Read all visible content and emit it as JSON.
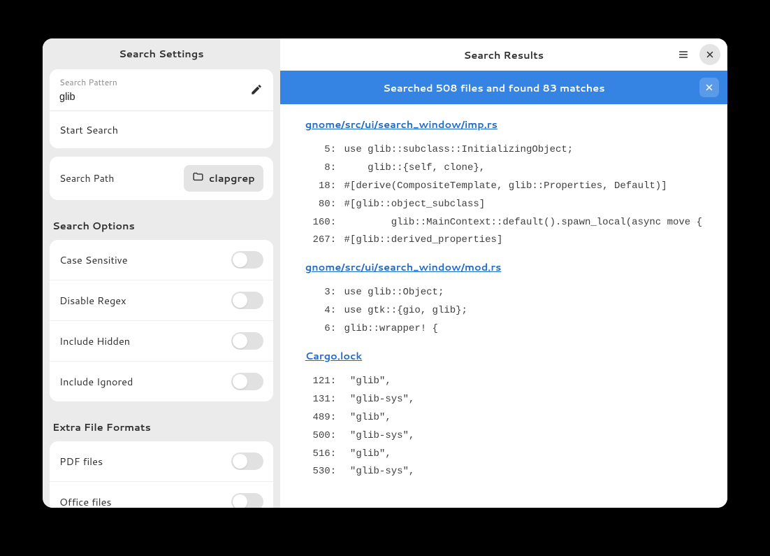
{
  "sidebar": {
    "title": "Search Settings",
    "pattern_label": "Search Pattern",
    "pattern_value": "glib",
    "start_search": "Start Search",
    "path_label": "Search Path",
    "path_value": "clapgrep",
    "options_title": "Search Options",
    "options": [
      {
        "label": "Case Sensitive"
      },
      {
        "label": "Disable Regex"
      },
      {
        "label": "Include Hidden"
      },
      {
        "label": "Include Ignored"
      }
    ],
    "extra_title": "Extra File Formats",
    "extra": [
      {
        "label": "PDF files"
      },
      {
        "label": "Office files"
      }
    ]
  },
  "main": {
    "title": "Search Results",
    "banner": "Searched 508 files and found 83 matches",
    "files": [
      {
        "path": "gnome/src/ui/search_window/imp.rs",
        "matches": [
          {
            "line": 5,
            "text": "use glib::subclass::InitializingObject;"
          },
          {
            "line": 8,
            "text": "    glib::{self, clone},"
          },
          {
            "line": 18,
            "text": "#[derive(CompositeTemplate, glib::Properties, Default)]"
          },
          {
            "line": 80,
            "text": "#[glib::object_subclass]"
          },
          {
            "line": 160,
            "text": "        glib::MainContext::default().spawn_local(async move {"
          },
          {
            "line": 267,
            "text": "#[glib::derived_properties]"
          }
        ]
      },
      {
        "path": "gnome/src/ui/search_window/mod.rs",
        "matches": [
          {
            "line": 3,
            "text": "use glib::Object;"
          },
          {
            "line": 4,
            "text": "use gtk::{gio, glib};"
          },
          {
            "line": 6,
            "text": "glib::wrapper! {"
          }
        ]
      },
      {
        "path": "Cargo.lock",
        "matches": [
          {
            "line": 121,
            "text": " \"glib\","
          },
          {
            "line": 131,
            "text": " \"glib-sys\","
          },
          {
            "line": 489,
            "text": " \"glib\","
          },
          {
            "line": 500,
            "text": " \"glib-sys\","
          },
          {
            "line": 516,
            "text": " \"glib\","
          },
          {
            "line": 530,
            "text": " \"glib-sys\","
          }
        ]
      }
    ]
  }
}
